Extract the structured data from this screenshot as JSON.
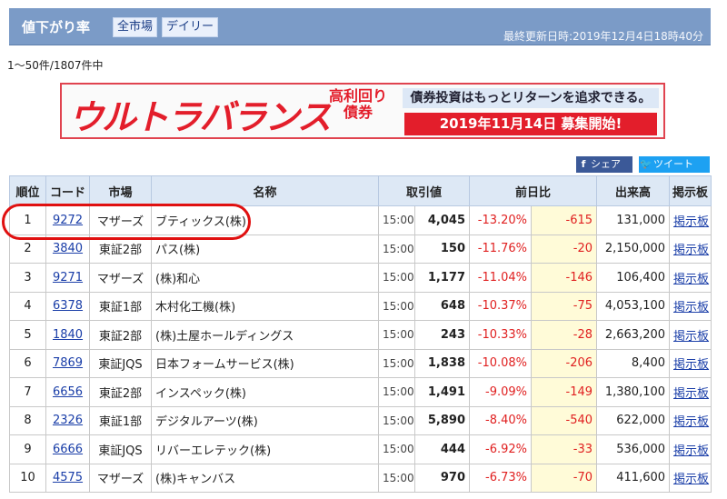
{
  "header": {
    "title": "値下がり率",
    "filter_market": "全市場",
    "filter_period": "デイリー",
    "updated": "最終更新日時:2019年12月4日18時40分"
  },
  "count_text": "1〜50件/1807件中",
  "banner": {
    "brand": "ウルトラバランス",
    "sub": "高利回り債券",
    "tagline": "債券投資はもっとリターンを追求できる。",
    "date": "2019年11月14日 募集開始!"
  },
  "share": {
    "facebook": "シェア",
    "twitter": "ツイート"
  },
  "table": {
    "headers": [
      "順位",
      "コード",
      "市場",
      "名称",
      "取引値",
      "前日比",
      "出来高",
      "掲示板"
    ],
    "rows": [
      {
        "rank": "1",
        "code": "9272",
        "market": "マザーズ",
        "name": "ブティックス(株)",
        "time": "15:00",
        "price": "4,045",
        "pct": "-13.20%",
        "diff": "-615",
        "volume": "131,000",
        "board": "掲示板"
      },
      {
        "rank": "2",
        "code": "3840",
        "market": "東証2部",
        "name": "パス(株)",
        "time": "15:00",
        "price": "150",
        "pct": "-11.76%",
        "diff": "-20",
        "volume": "2,150,000",
        "board": "掲示板"
      },
      {
        "rank": "3",
        "code": "9271",
        "market": "マザーズ",
        "name": "(株)和心",
        "time": "15:00",
        "price": "1,177",
        "pct": "-11.04%",
        "diff": "-146",
        "volume": "106,400",
        "board": "掲示板"
      },
      {
        "rank": "4",
        "code": "6378",
        "market": "東証1部",
        "name": "木村化工機(株)",
        "time": "15:00",
        "price": "648",
        "pct": "-10.37%",
        "diff": "-75",
        "volume": "4,053,100",
        "board": "掲示板"
      },
      {
        "rank": "5",
        "code": "1840",
        "market": "東証2部",
        "name": "(株)土屋ホールディングス",
        "time": "15:00",
        "price": "243",
        "pct": "-10.33%",
        "diff": "-28",
        "volume": "2,663,200",
        "board": "掲示板"
      },
      {
        "rank": "6",
        "code": "7869",
        "market": "東証JQS",
        "name": "日本フォームサービス(株)",
        "time": "15:00",
        "price": "1,838",
        "pct": "-10.08%",
        "diff": "-206",
        "volume": "8,400",
        "board": "掲示板"
      },
      {
        "rank": "7",
        "code": "6656",
        "market": "東証2部",
        "name": "インスペック(株)",
        "time": "15:00",
        "price": "1,491",
        "pct": "-9.09%",
        "diff": "-149",
        "volume": "1,380,100",
        "board": "掲示板"
      },
      {
        "rank": "8",
        "code": "2326",
        "market": "東証1部",
        "name": "デジタルアーツ(株)",
        "time": "15:00",
        "price": "5,890",
        "pct": "-8.40%",
        "diff": "-540",
        "volume": "622,000",
        "board": "掲示板"
      },
      {
        "rank": "9",
        "code": "6666",
        "market": "東証JQS",
        "name": "リバーエレテック(株)",
        "time": "15:00",
        "price": "444",
        "pct": "-6.92%",
        "diff": "-33",
        "volume": "536,000",
        "board": "掲示板"
      },
      {
        "rank": "10",
        "code": "4575",
        "market": "マザーズ",
        "name": "(株)キャンバス",
        "time": "15:00",
        "price": "970",
        "pct": "-6.73%",
        "diff": "-70",
        "volume": "411,600",
        "board": "掲示板"
      }
    ]
  }
}
